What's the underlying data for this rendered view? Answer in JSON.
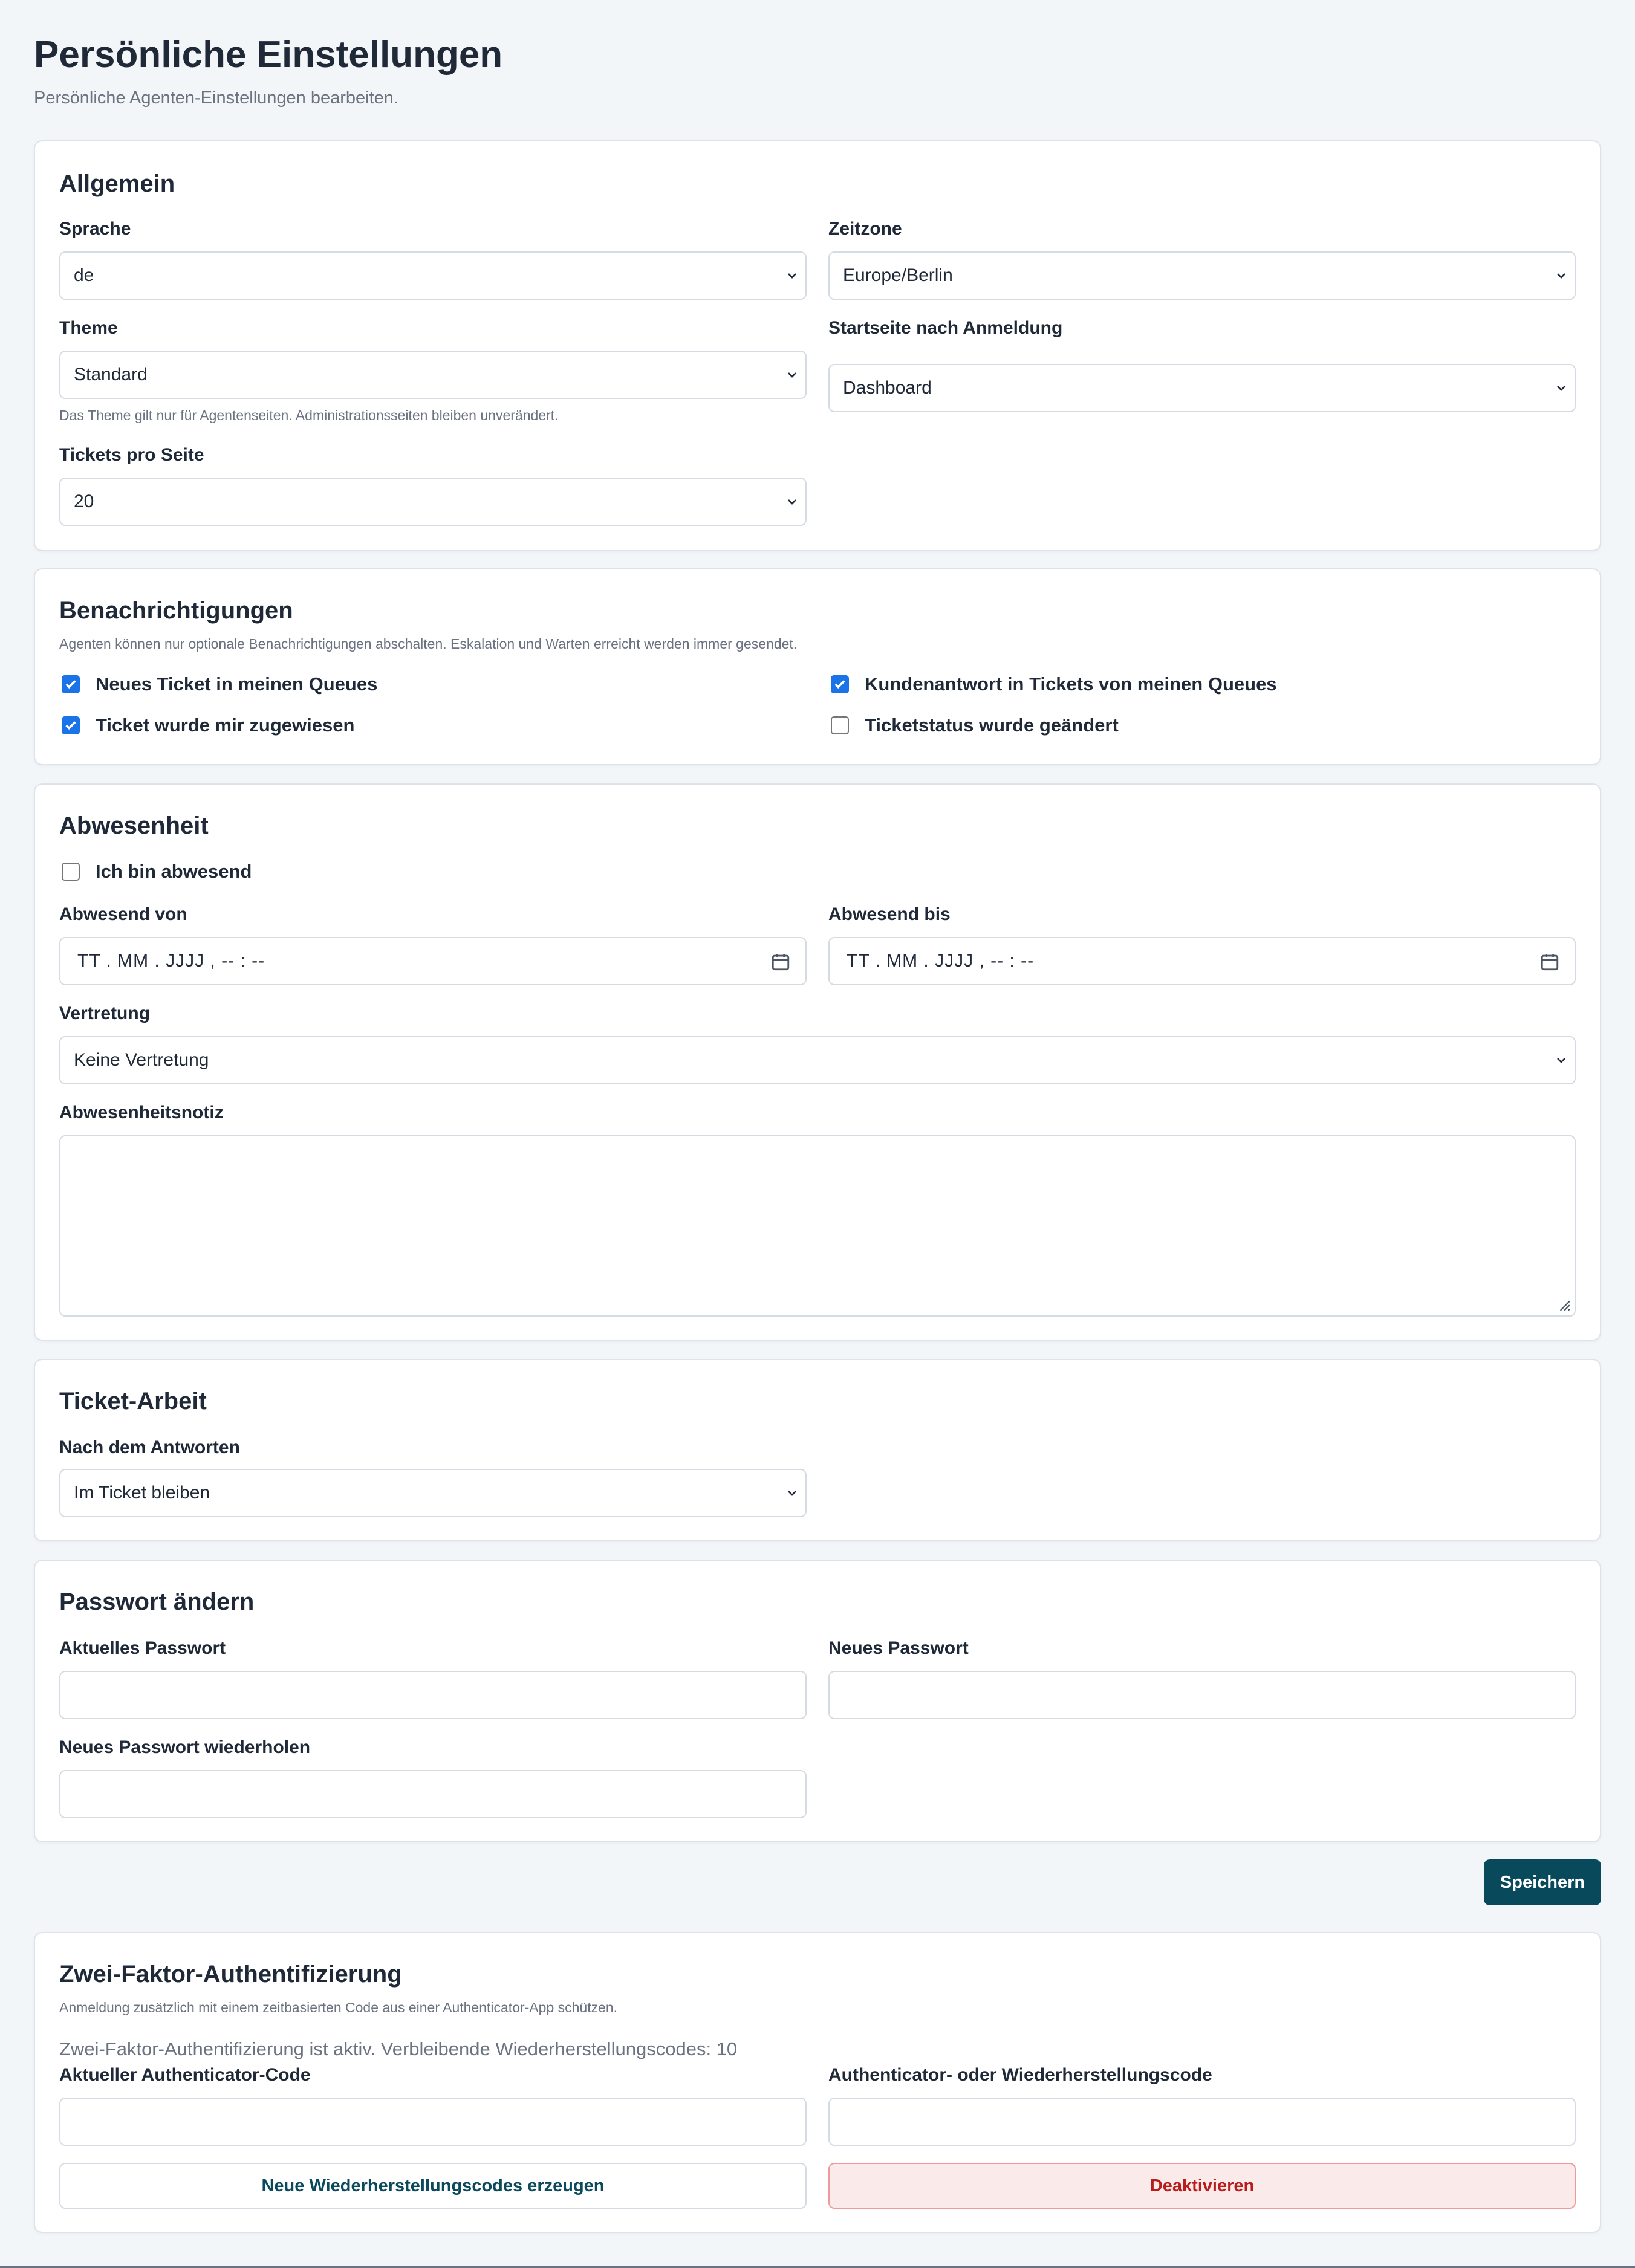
{
  "header": {
    "title": "Persönliche Einstellungen",
    "subtitle": "Persönliche Agenten-Einstellungen bearbeiten."
  },
  "general": {
    "title": "Allgemein",
    "language_label": "Sprache",
    "language_value": "de",
    "timezone_label": "Zeitzone",
    "timezone_value": "Europe/Berlin",
    "theme_label": "Theme",
    "theme_value": "Standard",
    "theme_hint": "Das Theme gilt nur für Agentenseiten. Administrationsseiten bleiben unverändert.",
    "startpage_label": "Startseite nach Anmeldung",
    "startpage_value": "Dashboard",
    "tickets_per_page_label": "Tickets pro Seite",
    "tickets_per_page_value": "20"
  },
  "notifications": {
    "title": "Benachrichtigungen",
    "hint": "Agenten können nur optionale Benachrichtigungen abschalten. Eskalation und Warten erreicht werden immer gesendet.",
    "items": [
      {
        "label": "Neues Ticket in meinen Queues",
        "checked": true
      },
      {
        "label": "Kundenantwort in Tickets von meinen Queues",
        "checked": true
      },
      {
        "label": "Ticket wurde mir zugewiesen",
        "checked": true
      },
      {
        "label": "Ticketstatus wurde geändert",
        "checked": false
      }
    ]
  },
  "absence": {
    "title": "Abwesenheit",
    "absent_label": "Ich bin abwesend",
    "absent_checked": false,
    "from_label": "Abwesend von",
    "from_placeholder": "TT . MM . JJJJ ,  -- : --",
    "until_label": "Abwesend bis",
    "until_placeholder": "TT . MM . JJJJ ,  -- : --",
    "substitute_label": "Vertretung",
    "substitute_value": "Keine Vertretung",
    "note_label": "Abwesenheitsnotiz",
    "note_value": ""
  },
  "ticket_work": {
    "title": "Ticket-Arbeit",
    "after_reply_label": "Nach dem Antworten",
    "after_reply_value": "Im Ticket bleiben"
  },
  "password": {
    "title": "Passwort ändern",
    "current_label": "Aktuelles Passwort",
    "new_label": "Neues Passwort",
    "repeat_label": "Neues Passwort wiederholen"
  },
  "actions": {
    "save_label": "Speichern"
  },
  "two_factor": {
    "title": "Zwei-Faktor-Authentifizierung",
    "hint": "Anmeldung zusätzlich mit einem zeitbasierten Code aus einer Authenticator-App schützen.",
    "status": "Zwei-Faktor-Authentifizierung ist aktiv. Verbleibende Wiederherstellungscodes: 10",
    "current_code_label": "Aktueller Authenticator-Code",
    "recovery_code_label": "Authenticator- oder Wiederherstellungscode",
    "regenerate_label": "Neue Wiederherstellungscodes erzeugen",
    "deactivate_label": "Deaktivieren"
  },
  "icons": {
    "select": "chevron-down-icon",
    "date": "calendar-icon",
    "checkbox": "checkmark-icon"
  },
  "colors": {
    "primary": "#084a5c",
    "checkbox": "#1a73e8",
    "danger_text": "#b91c1c",
    "danger_bg": "#fbeaea"
  }
}
